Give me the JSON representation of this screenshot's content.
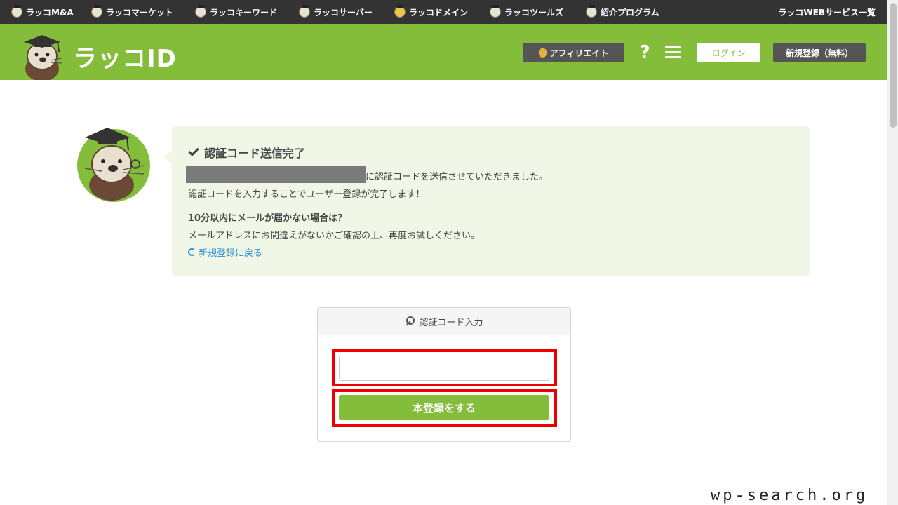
{
  "topbar": {
    "services": [
      {
        "label": "ラッコM&A",
        "icon": "otter-icon"
      },
      {
        "label": "ラッコマーケット",
        "icon": "otter-icon"
      },
      {
        "label": "ラッコキーワード",
        "icon": "otter-icon"
      },
      {
        "label": "ラッコサーバー",
        "icon": "otter-icon"
      },
      {
        "label": "ラッコドメイン",
        "icon": "otter-icon"
      },
      {
        "label": "ラッコツールズ",
        "icon": "otter-icon"
      },
      {
        "label": "紹介プログラム",
        "icon": "otter-icon"
      }
    ],
    "all_services": "ラッコWEBサービス一覧"
  },
  "header": {
    "brand": "ラッコID",
    "affiliate": "アフィリエイト",
    "help_symbol": "?",
    "login": "ログイン",
    "register": "新規登録（無料）"
  },
  "message": {
    "title": "認証コード送信完了",
    "line1": "に認証コードを送信させていただきました。",
    "line2": "認証コードを入力することでユーザー登録が完了します！",
    "heading2": "10分以内にメールが届かない場合は？",
    "line3": "メールアドレスにお間違えがないかご確認の上、再度お試しください。",
    "back_link": "新規登録に戻る"
  },
  "auth_panel": {
    "title": "認証コード入力",
    "input_value": "",
    "submit": "本登録をする"
  },
  "watermark": "wp-search.org",
  "colors": {
    "brand_green": "#84bd3a",
    "topbar": "#333333",
    "highlight_red": "#ee0000",
    "link_blue": "#2f8fd0"
  }
}
